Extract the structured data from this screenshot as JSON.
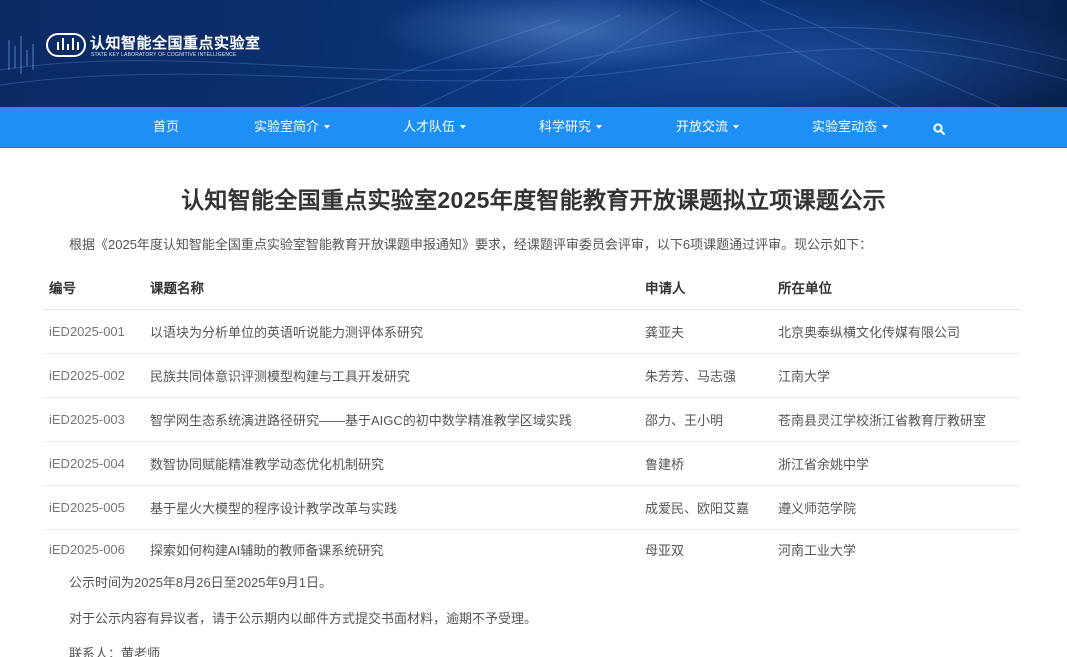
{
  "header": {
    "logo_cn": "认知智能全国重点实验室",
    "logo_en": "STATE KEY LABORATORY OF COGNITIVE INTELLIGENCE"
  },
  "nav": {
    "items": [
      {
        "label": "首页",
        "dropdown": false
      },
      {
        "label": "实验室简介",
        "dropdown": true
      },
      {
        "label": "人才队伍",
        "dropdown": true
      },
      {
        "label": "科学研究",
        "dropdown": true
      },
      {
        "label": "开放交流",
        "dropdown": true
      },
      {
        "label": "实验室动态",
        "dropdown": true
      }
    ],
    "search_icon": "search-icon"
  },
  "article": {
    "title": "认知智能全国重点实验室2025年度智能教育开放课题拟立项课题公示",
    "intro": "根据《2025年度认知智能全国重点实验室智能教育开放课题申报通知》要求，经课题评审委员会评审，以下6项课题通过评审。现公示如下：",
    "table": {
      "headers": [
        "编号",
        "课题名称",
        "申请人",
        "所在单位"
      ],
      "rows": [
        [
          "iED2025-001",
          "以语块为分析单位的英语听说能力测评体系研究",
          "龚亚夫",
          "北京奥泰纵横文化传媒有限公司"
        ],
        [
          "iED2025-002",
          "民族共同体意识评测模型构建与工具开发研究",
          "朱芳芳、马志强",
          "江南大学"
        ],
        [
          "iED2025-003",
          "智学网生态系统演进路径研究——基于AIGC的初中数学精准教学区域实践",
          "邵力、王小明",
          "苍南县灵江学校浙江省教育厅教研室"
        ],
        [
          "iED2025-004",
          "数智协同赋能精准教学动态优化机制研究",
          "鲁建桥",
          "浙江省余姚中学"
        ],
        [
          "iED2025-005",
          "基于星火大模型的程序设计教学改革与实践",
          "成爱民、欧阳艾嘉",
          "遵义师范学院"
        ],
        [
          "iED2025-006",
          "探索如何构建AI辅助的教师备课系统研究",
          "母亚双",
          "河南工业大学"
        ]
      ]
    },
    "period": "公示时间为2025年8月26日至2025年9月1日。",
    "objection": "对于公示内容有异议者，请于公示期内以邮件方式提交书面材料，逾期不予受理。",
    "contact": "联系人：黄老师"
  }
}
